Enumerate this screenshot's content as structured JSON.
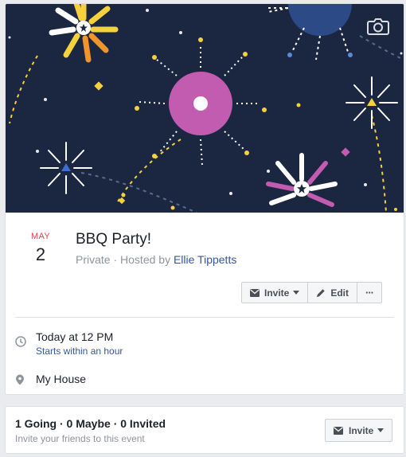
{
  "event": {
    "month": "MAY",
    "day": "2",
    "title": "BBQ Party!",
    "privacy": "Private",
    "separator": " · ",
    "hosted_by_prefix": "Hosted by ",
    "host": "Ellie Tippetts"
  },
  "actions": {
    "invite_label": "Invite",
    "edit_label": "Edit",
    "more_label": "···"
  },
  "details": {
    "time": "Today at 12 PM",
    "time_relative": "Starts within an hour",
    "location": "My House"
  },
  "rsvp": {
    "counts": "1 Going · 0 Maybe · 0 Invited",
    "prompt": "Invite your friends to this event",
    "invite_label": "Invite"
  },
  "icons": {
    "cover_camera": "camera-icon",
    "invite": "envelope-icon",
    "edit": "pencil-icon",
    "time": "clock-icon",
    "location": "map-pin-icon"
  },
  "colors": {
    "cover_bg": "#1b2641",
    "month": "#e0414d",
    "link": "#365899",
    "firework_pink": "#c25cb0",
    "firework_yellow": "#f5d13d",
    "firework_orange": "#f0942c"
  }
}
